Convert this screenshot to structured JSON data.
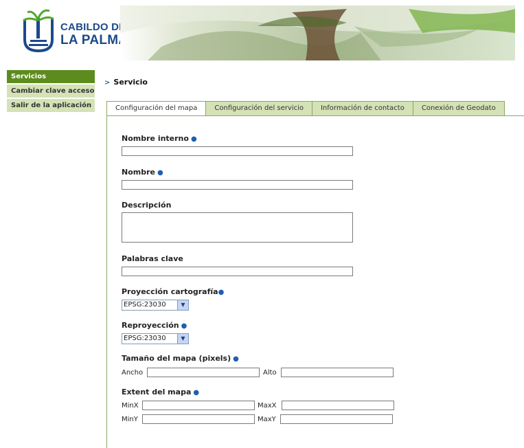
{
  "brand": {
    "line1": "CABILDO DE",
    "line2": "LA PALMA"
  },
  "sidebar": {
    "items": [
      {
        "label": "Servicios"
      },
      {
        "label": "Cambiar clave acceso"
      },
      {
        "label": "Salir de la aplicación"
      }
    ]
  },
  "breadcrumb": {
    "arrow": ">",
    "label": "Servicio"
  },
  "tabs": [
    {
      "label": "Configuración del mapa"
    },
    {
      "label": "Configuración del servicio"
    },
    {
      "label": "Información de contacto"
    },
    {
      "label": "Conexión de Geodato"
    }
  ],
  "form": {
    "required_marker": "●",
    "nombre_interno": {
      "label": "Nombre interno",
      "value": ""
    },
    "nombre": {
      "label": "Nombre",
      "value": ""
    },
    "descripcion": {
      "label": "Descripción",
      "value": ""
    },
    "palabras_clave": {
      "label": "Palabras clave",
      "value": ""
    },
    "proyeccion": {
      "label": "Proyección cartografía",
      "selected": "EPSG:23030"
    },
    "reproyeccion": {
      "label": "Reproyección",
      "selected": "EPSG:23030"
    },
    "tamano": {
      "label": "Tamaño del mapa (pixels)",
      "ancho_label": "Ancho",
      "alto_label": "Alto"
    },
    "extent": {
      "label": "Extent del mapa",
      "minx_label": "MinX",
      "maxx_label": "MaxX",
      "miny_label": "MinY",
      "maxy_label": "MaxY"
    }
  },
  "colors": {
    "sidebar_active": "#5d8c1e",
    "sidebar_inactive": "#d4e2b6",
    "brand": "#1b4a8a",
    "required": "#1f5fb0"
  }
}
